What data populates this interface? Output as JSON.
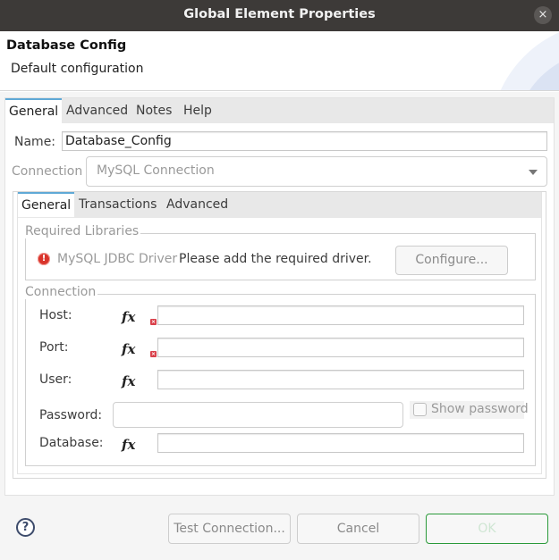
{
  "window": {
    "title": "Global Element Properties",
    "close_icon": "×"
  },
  "header": {
    "title": "Database Config",
    "subtitle": "Default configuration"
  },
  "tabs": [
    {
      "label": "General",
      "active": true
    },
    {
      "label": "Advanced",
      "active": false
    },
    {
      "label": "Notes",
      "active": false
    },
    {
      "label": "Help",
      "active": false
    }
  ],
  "form": {
    "name_label": "Name:",
    "name_value": "Database_Config",
    "connection_label": "Connection",
    "connection_value": "MySQL Connection"
  },
  "inner_tabs": [
    {
      "label": "General",
      "active": true
    },
    {
      "label": "Transactions",
      "active": false
    },
    {
      "label": "Advanced",
      "active": false
    }
  ],
  "required_libraries": {
    "legend": "Required Libraries",
    "error_icon": "!",
    "driver_name": "MySQL JDBC Driver",
    "message": "Please add the required driver.",
    "configure_button": "Configure..."
  },
  "connection": {
    "legend": "Connection",
    "fx_symbol": "fx",
    "required_mark": "×",
    "fields": {
      "host": {
        "label": "Host:",
        "value": "",
        "required": true
      },
      "port": {
        "label": "Port:",
        "value": "",
        "required": true
      },
      "user": {
        "label": "User:",
        "value": "",
        "required": false
      },
      "password": {
        "label": "Password:",
        "value": ""
      },
      "database": {
        "label": "Database:",
        "value": "",
        "required": false
      }
    },
    "show_password_label": "Show password",
    "show_password_checked": false
  },
  "footer": {
    "help_icon": "?",
    "test_connection_button": "Test Connection...",
    "cancel_button": "Cancel",
    "ok_button": "OK"
  },
  "colors": {
    "titlebar": "#3d3a38",
    "tab_accent": "#5fa9d6",
    "error_red": "#d9342b",
    "ok_border": "#2a9a3a"
  }
}
